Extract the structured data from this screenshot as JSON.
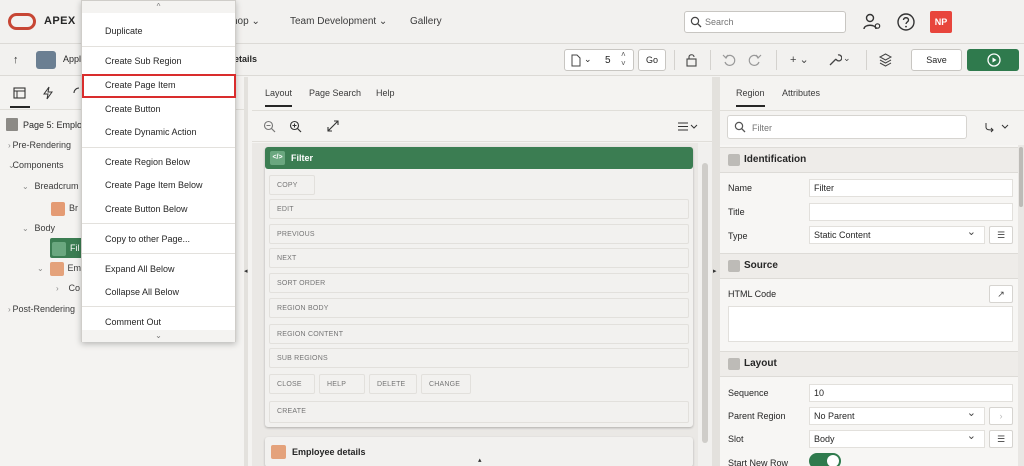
{
  "header": {
    "brand": "APEX",
    "nav": [
      "hop ⌄",
      "Team Development ⌄",
      "Gallery"
    ],
    "search_placeholder": "Search",
    "user_initials": "NP",
    "icons": [
      "search-icon",
      "user-gear-icon",
      "help-icon"
    ]
  },
  "toolbar": {
    "up_arrow": "↑",
    "app_label": "Appl",
    "page_title_suffix": "etails",
    "page_number": "5",
    "go_label": "Go",
    "save_label": "Save",
    "add_label": "+ ⌄",
    "wrench_label": "⌄"
  },
  "tree": {
    "page_label": "Page 5: Employ",
    "items": [
      {
        "label": "Pre-Rendering",
        "indent": 0,
        "expanded": false
      },
      {
        "label": "Components",
        "indent": 0,
        "expanded": true
      },
      {
        "label": "Breadcrum",
        "indent": 1,
        "expanded": true
      },
      {
        "label": "Br",
        "indent": 2,
        "icon": "breadcrumb-icon"
      },
      {
        "label": "Body",
        "indent": 1,
        "expanded": true
      },
      {
        "label": "Fil",
        "indent": 2,
        "icon": "static-region-icon",
        "selected": true
      },
      {
        "label": "Em",
        "indent": 2,
        "icon": "report-region-icon",
        "expanded": true
      },
      {
        "label": "Co",
        "indent": 3,
        "expanded": false
      },
      {
        "label": "Post-Rendering",
        "indent": 0,
        "expanded": false
      }
    ]
  },
  "context_menu": {
    "items": [
      {
        "label": "Duplicate",
        "separator_after": true
      },
      {
        "label": "Create Sub Region",
        "separator_after": true
      },
      {
        "label": "Create Page Item",
        "highlighted": true
      },
      {
        "label": "Create Button"
      },
      {
        "label": "Create Dynamic Action",
        "separator_after": true
      },
      {
        "label": "Create Region Below"
      },
      {
        "label": "Create Page Item Below"
      },
      {
        "label": "Create Button Below",
        "separator_after": true
      },
      {
        "label": "Copy to other Page...",
        "separator_after": true
      },
      {
        "label": "Expand All Below"
      },
      {
        "label": "Collapse All Below",
        "separator_after": true
      },
      {
        "label": "Comment Out"
      }
    ],
    "scroll_up": "^",
    "scroll_down": "⌄"
  },
  "center": {
    "tabs": [
      "Layout",
      "Page Search",
      "Help"
    ],
    "active_tab": "Layout",
    "region_filter": {
      "title": "Filter",
      "icon_text": "</>",
      "slots_full": [
        "EDIT",
        "PREVIOUS",
        "NEXT",
        "SORT ORDER",
        "REGION BODY",
        "REGION CONTENT",
        "SUB REGIONS"
      ],
      "slot_copy": "COPY",
      "slots_row": [
        "CLOSE",
        "HELP",
        "DELETE",
        "CHANGE"
      ],
      "slot_create": "CREATE"
    },
    "region_employee": {
      "title": "Employee details"
    }
  },
  "right": {
    "tabs": [
      "Region",
      "Attributes"
    ],
    "active_tab": "Region",
    "filter_placeholder": "Filter",
    "groups": {
      "identification": "Identification",
      "source": "Source",
      "layout": "Layout"
    },
    "fields": {
      "name_label": "Name",
      "name_value": "Filter",
      "title_label": "Title",
      "title_value": "",
      "type_label": "Type",
      "type_value": "Static Content",
      "html_label": "HTML Code",
      "sequence_label": "Sequence",
      "sequence_value": "10",
      "parent_label": "Parent Region",
      "parent_value": "No Parent",
      "slot_label": "Slot",
      "slot_value": "Body",
      "newrow_label": "Start New Row"
    }
  },
  "colors": {
    "accent_green": "#3b7d52",
    "brand_red": "#c74634",
    "highlight_red": "#d92d2d",
    "avatar_red": "#e8453c"
  }
}
